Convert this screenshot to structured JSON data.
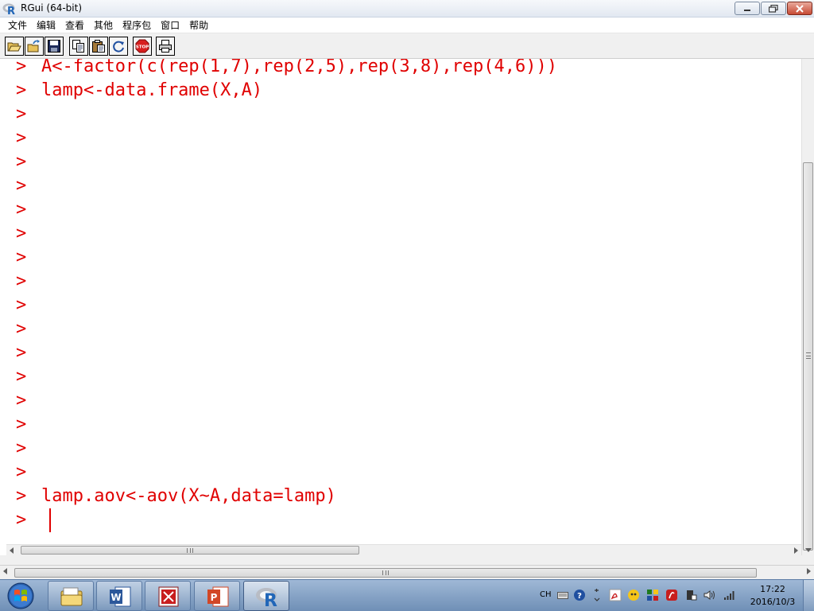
{
  "window": {
    "title": "RGui (64-bit)",
    "icon": "r-logo-icon"
  },
  "menu": [
    "文件",
    "编辑",
    "查看",
    "其他",
    "程序包",
    "窗口",
    "帮助"
  ],
  "toolbar": {
    "buttons": [
      "open-script-icon",
      "load-workspace-icon",
      "save-icon",
      "copy-icon",
      "paste-icon",
      "refresh-icon",
      "stop-icon",
      "print-icon"
    ],
    "stop_label": "STOP"
  },
  "console": {
    "prompt": ">",
    "lines": [
      "A<-factor(c(rep(1,7),rep(2,5),rep(3,8),rep(4,6)))",
      "lamp<-data.frame(X,A)",
      "",
      "",
      "",
      "",
      "",
      "",
      "",
      "",
      "",
      "",
      "",
      "",
      "",
      "",
      "",
      "",
      "lamp.aov<-aov(X~A,data=lamp)",
      ""
    ],
    "text_color": "#e00000"
  },
  "taskbar": {
    "apps": [
      "explorer-icon",
      "word-icon",
      "pdf-reader-icon",
      "powerpoint-icon",
      "r-logo-icon"
    ],
    "active_app": "r-logo-icon",
    "tray_language": "CH",
    "time": "17:22",
    "date": "2016/10/3"
  }
}
